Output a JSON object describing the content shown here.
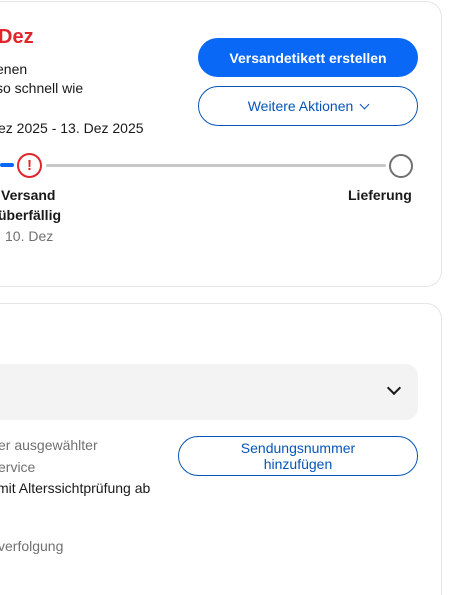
{
  "status_card": {
    "title": "Dez",
    "message_line1": "enen",
    "message_line2": "so schnell wie",
    "date_range": "ez 2025 - 13. Dez 2025",
    "create_label_button": "Versandetikett erstellen",
    "more_actions_button": "Weitere Aktionen",
    "progress": {
      "alert_symbol": "!",
      "step_versand": "Versand",
      "step_status": "überfällig",
      "step_date": "10. Dez",
      "step_delivery": "Lieferung"
    }
  },
  "shipping_card": {
    "line1": "er ausgewählter",
    "line2": "ervice",
    "line3": "mit Alterssichtprüfung ab",
    "line4": "verfolgung",
    "add_tracking_button_line1": "Sendungsnummer",
    "add_tracking_button_line2": "hinzufügen"
  },
  "colors": {
    "accent": "#0968f6",
    "link": "#0654ba",
    "alert": "#e0262b"
  }
}
